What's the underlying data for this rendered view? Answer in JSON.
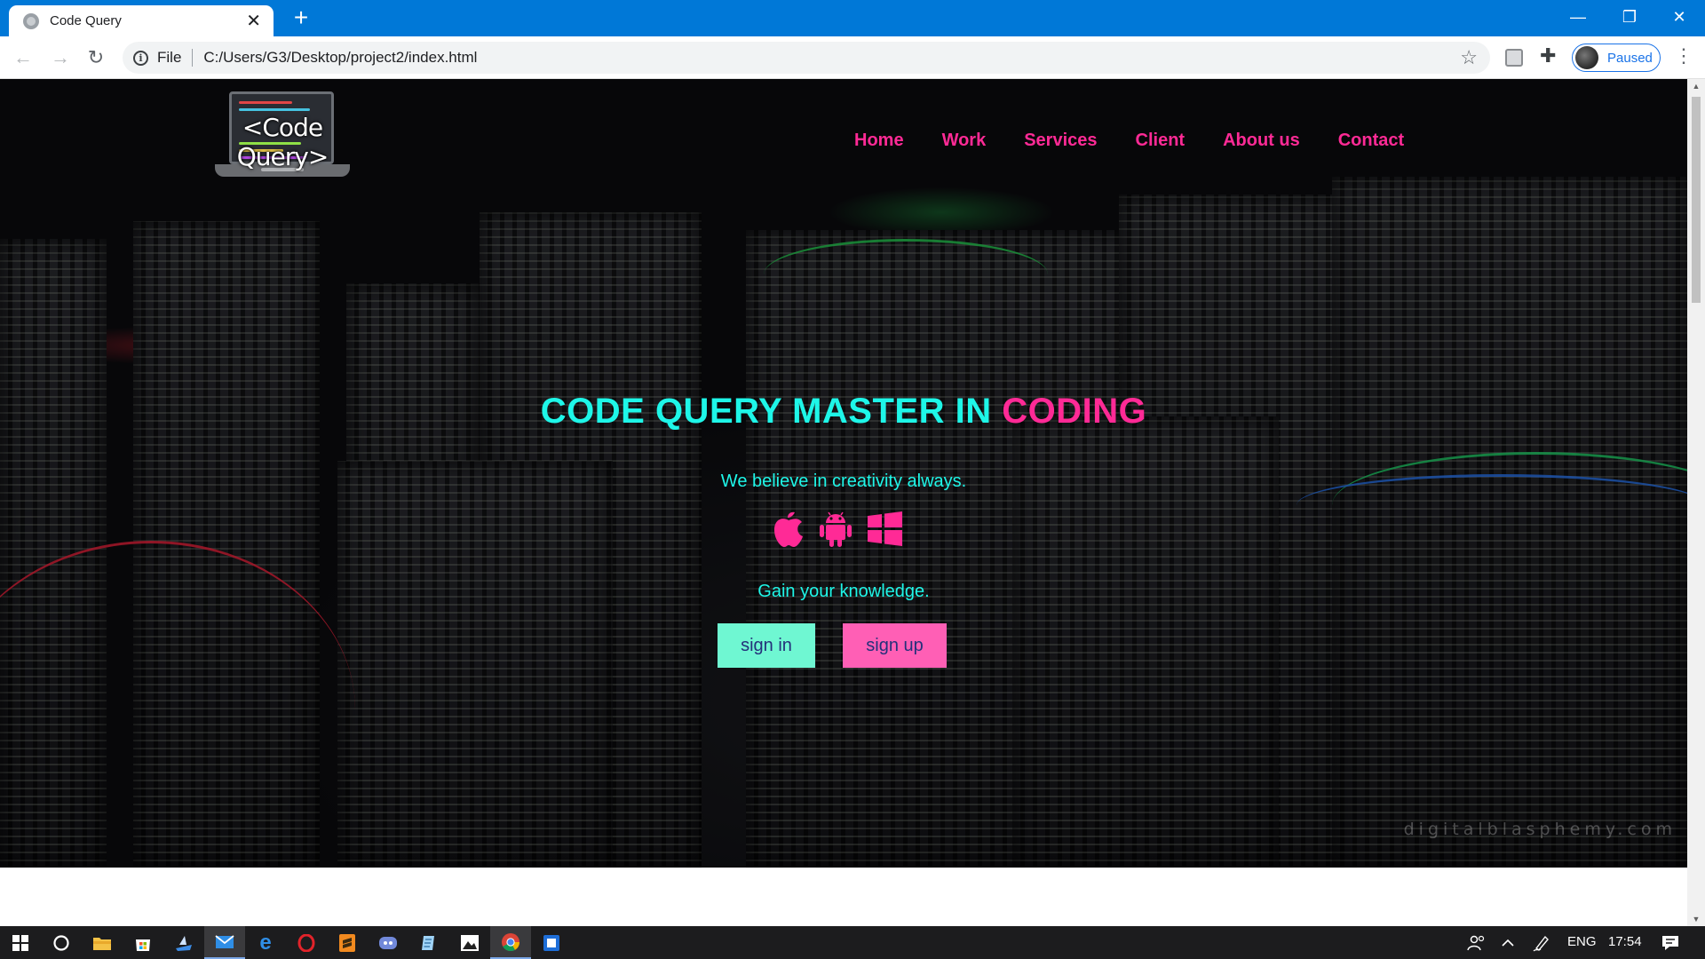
{
  "browser": {
    "tab_title": "Code Query",
    "tab_close": "✕",
    "new_tab": "+",
    "window": {
      "minimize": "—",
      "maximize": "❐",
      "close": "✕"
    },
    "scheme": "File",
    "url": "C:/Users/G3/Desktop/project2/index.html",
    "profile_status": "Paused"
  },
  "site": {
    "logo_text": "<Code Query>",
    "nav": [
      "Home",
      "Work",
      "Services",
      "Client",
      "About us",
      "Contact"
    ],
    "headline_main": "CODE QUERY MASTER IN ",
    "headline_accent": "CODING",
    "tagline": "We believe in creativity always.",
    "platform_icons": [
      "apple-icon",
      "android-icon",
      "windows-icon"
    ],
    "subline": "Gain your knowledge.",
    "buttons": {
      "signin": "sign in",
      "signup": "sign up"
    },
    "watermark": "digitalblasphemy.com",
    "colors": {
      "cyan": "#1ef6e8",
      "pink": "#ff2a96",
      "signin_bg": "#6ff7d2",
      "signup_bg": "#ff5fb5",
      "button_text": "#24307a"
    }
  },
  "taskbar": {
    "language": "ENG",
    "time": "17:54",
    "apps": [
      "start-icon",
      "search-icon",
      "file-explorer-icon",
      "store-icon",
      "app-icon",
      "mail-icon",
      "edge-icon",
      "opera-icon",
      "sublime-icon",
      "discord-icon",
      "notepad-icon",
      "photos-icon",
      "chrome-icon",
      "app-icon"
    ]
  }
}
